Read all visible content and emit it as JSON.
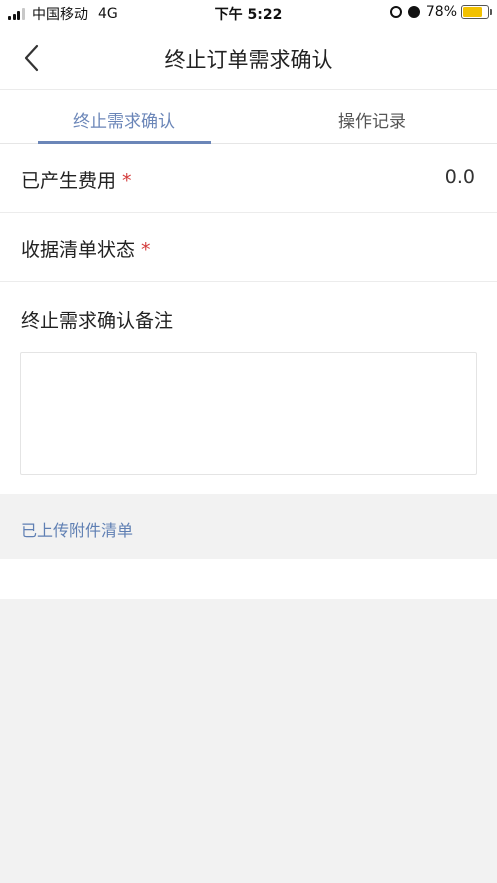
{
  "status_bar": {
    "carrier": "中国移动",
    "network": "4G",
    "time": "下午 5:22",
    "battery_percent_text": "78%",
    "battery_level": 0.78,
    "battery_color": "#f2c100"
  },
  "header": {
    "title": "终止订单需求确认",
    "back_icon": "chevron-left-icon"
  },
  "tabs": [
    {
      "label": "终止需求确认",
      "active": true
    },
    {
      "label": "操作记录",
      "active": false
    }
  ],
  "form": {
    "fee": {
      "label": "已产生费用",
      "required_mark": "*",
      "value": "0.0"
    },
    "receipt_status": {
      "label": "收据清单状态",
      "required_mark": "*",
      "value": ""
    },
    "remark": {
      "label": "终止需求确认备注",
      "value": ""
    }
  },
  "attachments": {
    "label": "已上传附件清单"
  },
  "colors": {
    "accent": "#6b86b8",
    "required": "#d33a3a",
    "link": "#5f7fb3",
    "background": "#f2f2f2"
  }
}
